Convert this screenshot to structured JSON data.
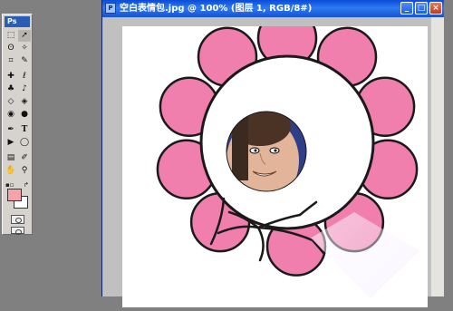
{
  "app": {
    "logo_text": "Ps"
  },
  "document": {
    "title": "空白表情包.jpg @ 100% (图层 1, RGB/8#)",
    "buttons": {
      "minimize": "_",
      "maximize": "□",
      "close": "×"
    }
  },
  "toolbox": {
    "tools": [
      "marquee-tool",
      "move-tool",
      "lasso-tool",
      "magic-wand-tool",
      "crop-tool",
      "slice-tool",
      "healing-brush-tool",
      "brush-tool",
      "clone-stamp-tool",
      "history-brush-tool",
      "eraser-tool",
      "paint-bucket-tool",
      "blur-tool",
      "dodge-tool",
      "pen-tool",
      "type-tool",
      "path-selection-tool",
      "shape-tool",
      "notes-tool",
      "eyedropper-tool",
      "hand-tool",
      "zoom-tool"
    ],
    "foreground_color": "#f4a3a6",
    "background_color": "#ffffff"
  },
  "colors": {
    "petal": "#f07fae",
    "petal_dark": "#d8649a",
    "outline": "#1a1a1a"
  }
}
